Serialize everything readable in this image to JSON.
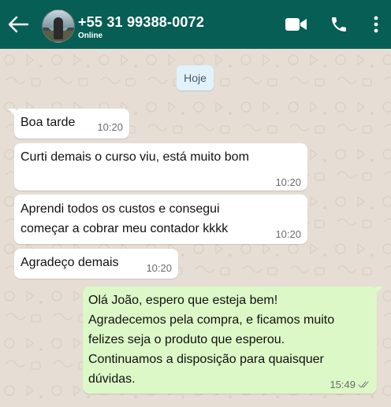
{
  "header": {
    "contact_name": "+55 31 99388-0072",
    "status": "Online",
    "bg_color": "#075e54"
  },
  "chat": {
    "date_label": "Hoje",
    "incoming": [
      {
        "text": "Boa tarde",
        "time": "10:20"
      },
      {
        "text": "Curti demais o curso viu, está muito bom",
        "time": "10:20"
      },
      {
        "lines": [
          "Aprendi todos os custos e consegui",
          "começar a cobrar meu contador kkkk"
        ],
        "time": "10:20"
      },
      {
        "text": "Agradeço demais",
        "time": "10:20"
      }
    ],
    "outgoing": [
      {
        "lines": [
          "Olá João, espero que esteja bem!",
          "Agradecemos pela compra, e ficamos muito",
          "felizes seja o produto que esperou.",
          "Continuamos a disposição para quaisquer",
          "dúvidas."
        ],
        "time": "15:49",
        "status_icon": "double-check-icon"
      }
    ]
  },
  "icons": [
    "back-arrow-icon",
    "video-call-icon",
    "phone-icon",
    "more-vert-icon"
  ],
  "colors": {
    "incoming_bubble": "#ffffff",
    "outgoing_bubble": "#dcf8c6",
    "chat_bg": "#e6ddd4"
  }
}
